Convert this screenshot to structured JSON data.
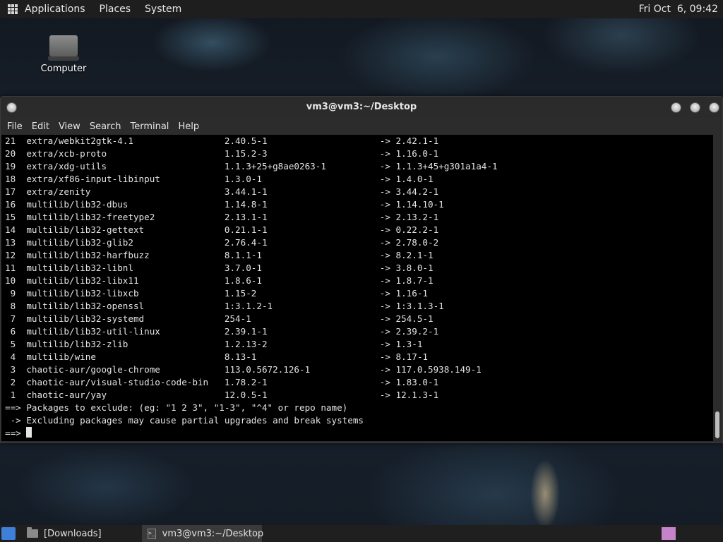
{
  "top_panel": {
    "menus": [
      "Applications",
      "Places",
      "System"
    ],
    "clock": "Fri Oct  6, 09:42"
  },
  "desktop": {
    "icon_label": "Computer"
  },
  "window": {
    "title": "vm3@vm3:~/Desktop",
    "menus": [
      "File",
      "Edit",
      "View",
      "Search",
      "Terminal",
      "Help"
    ]
  },
  "terminal": {
    "lines": [
      "21  extra/webkit2gtk-4.1                 2.40.5-1                     -> 2.42.1-1",
      "20  extra/xcb-proto                      1.15.2-3                     -> 1.16.0-1",
      "19  extra/xdg-utils                      1.1.3+25+g8ae0263-1          -> 1.1.3+45+g301a1a4-1",
      "18  extra/xf86-input-libinput            1.3.0-1                      -> 1.4.0-1",
      "17  extra/zenity                         3.44.1-1                     -> 3.44.2-1",
      "16  multilib/lib32-dbus                  1.14.8-1                     -> 1.14.10-1",
      "15  multilib/lib32-freetype2             2.13.1-1                     -> 2.13.2-1",
      "14  multilib/lib32-gettext               0.21.1-1                     -> 0.22.2-1",
      "13  multilib/lib32-glib2                 2.76.4-1                     -> 2.78.0-2",
      "12  multilib/lib32-harfbuzz              8.1.1-1                      -> 8.2.1-1",
      "11  multilib/lib32-libnl                 3.7.0-1                      -> 3.8.0-1",
      "10  multilib/lib32-libx11                1.8.6-1                      -> 1.8.7-1",
      " 9  multilib/lib32-libxcb                1.15-2                       -> 1.16-1",
      " 8  multilib/lib32-openssl               1:3.1.2-1                    -> 1:3.1.3-1",
      " 7  multilib/lib32-systemd               254-1                        -> 254.5-1",
      " 6  multilib/lib32-util-linux            2.39.1-1                     -> 2.39.2-1",
      " 5  multilib/lib32-zlib                  1.2.13-2                     -> 1.3-1",
      " 4  multilib/wine                        8.13-1                       -> 8.17-1",
      " 3  chaotic-aur/google-chrome            113.0.5672.126-1             -> 117.0.5938.149-1",
      " 2  chaotic-aur/visual-studio-code-bin   1.78.2-1                     -> 1.83.0-1",
      " 1  chaotic-aur/yay                      12.0.5-1                     -> 12.1.3-1",
      "==> Packages to exclude: (eg: \"1 2 3\", \"1-3\", \"^4\" or repo name)",
      " -> Excluding packages may cause partial upgrades and break systems"
    ],
    "prompt": "==> "
  },
  "taskbar": {
    "tasks": [
      "[Downloads]",
      "vm3@vm3:~/Desktop"
    ]
  }
}
